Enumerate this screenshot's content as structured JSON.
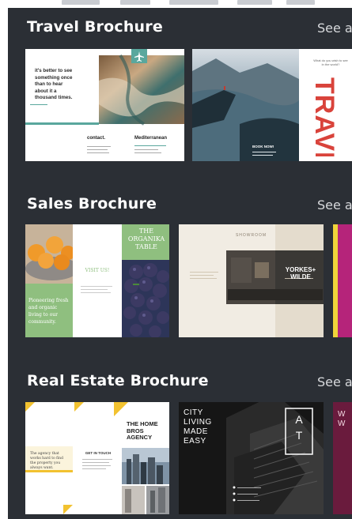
{
  "sections": [
    {
      "title": "Travel Brochure",
      "see_all": "See a",
      "templates": [
        {
          "quote": "it's better to see something once than to hear about it a thousand times.",
          "contact_heading": "contact.",
          "location_heading": "Mediterranean",
          "icon": "plane-icon"
        },
        {
          "question": "What do you wish to see in the world?",
          "title": "TRAVEL",
          "info_heading": "BOOK NOW!"
        }
      ]
    },
    {
      "title": "Sales Brochure",
      "see_all": "See a",
      "templates": [
        {
          "title": "THE ORGANIKA TABLE",
          "visit_label": "VISIT US!",
          "tagline": "Pioneering fresh and organic living to our community."
        },
        {
          "heading": "SHOWROOM",
          "title": "YORKES+ WILDE"
        },
        {}
      ]
    },
    {
      "title": "Real Estate Brochure",
      "see_all": "See a",
      "templates": [
        {
          "title": "THE HOME BROS AGENCY",
          "contact_label": "GET IN TOUCH",
          "tagline": "The agency that works hard to find the property you always want."
        },
        {
          "title": "CITY LIVING MADE EASY",
          "letters": [
            "A",
            "T"
          ]
        },
        {
          "title": "W W"
        }
      ]
    }
  ],
  "colors": {
    "panel": "#2b2f35",
    "travel_accent": "#5aa79d",
    "travel_red": "#d9433b",
    "organika_green": "#8fbf7f",
    "realestate_yellow": "#f2c230",
    "sales_magenta": "#b5247a"
  }
}
